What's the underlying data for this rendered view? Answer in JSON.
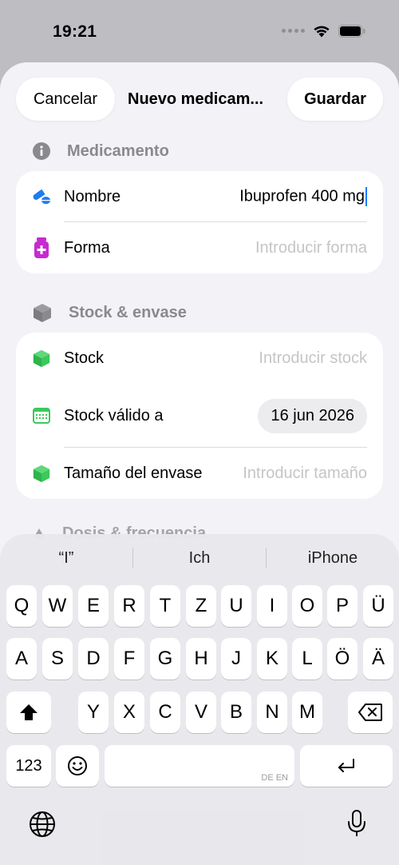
{
  "status_bar": {
    "time": "19:21"
  },
  "nav": {
    "cancel_label": "Cancelar",
    "title": "Nuevo medicam...",
    "save_label": "Guardar"
  },
  "sections": {
    "medicamento": {
      "title": "Medicamento",
      "icon": "info-icon",
      "rows": {
        "nombre": {
          "label": "Nombre",
          "value": "Ibuprofen 400 mg",
          "icon": "pills-icon"
        },
        "forma": {
          "label": "Forma",
          "placeholder": "Introducir forma",
          "icon": "medicine-bottle-icon"
        }
      }
    },
    "stock": {
      "title": "Stock & envase",
      "icon": "box-icon",
      "rows": {
        "stock": {
          "label": "Stock",
          "placeholder": "Introducir stock",
          "icon": "cube-icon"
        },
        "valido": {
          "label": "Stock válido a",
          "value": "16 jun 2026",
          "icon": "calendar-icon"
        },
        "tamano": {
          "label": "Tamaño del envase",
          "placeholder": "Introducir tamaño",
          "icon": "cube-icon"
        }
      }
    },
    "dosis": {
      "title": "Dosis & frecuencia"
    }
  },
  "keyboard": {
    "suggestions": [
      "“I”",
      "Ich",
      "iPhone"
    ],
    "row1": [
      "Q",
      "W",
      "E",
      "R",
      "T",
      "Z",
      "U",
      "I",
      "O",
      "P",
      "Ü"
    ],
    "row2": [
      "A",
      "S",
      "D",
      "F",
      "G",
      "H",
      "J",
      "K",
      "L",
      "Ö",
      "Ä"
    ],
    "row3": [
      "Y",
      "X",
      "C",
      "V",
      "B",
      "N",
      "M"
    ],
    "numbers_label": "123",
    "space_hint": "DE EN"
  },
  "colors": {
    "accent": "#0a7cff",
    "pill_blue": "#1e7cf0",
    "bottle_magenta": "#c72ad1",
    "cube_green": "#3cc85a"
  }
}
